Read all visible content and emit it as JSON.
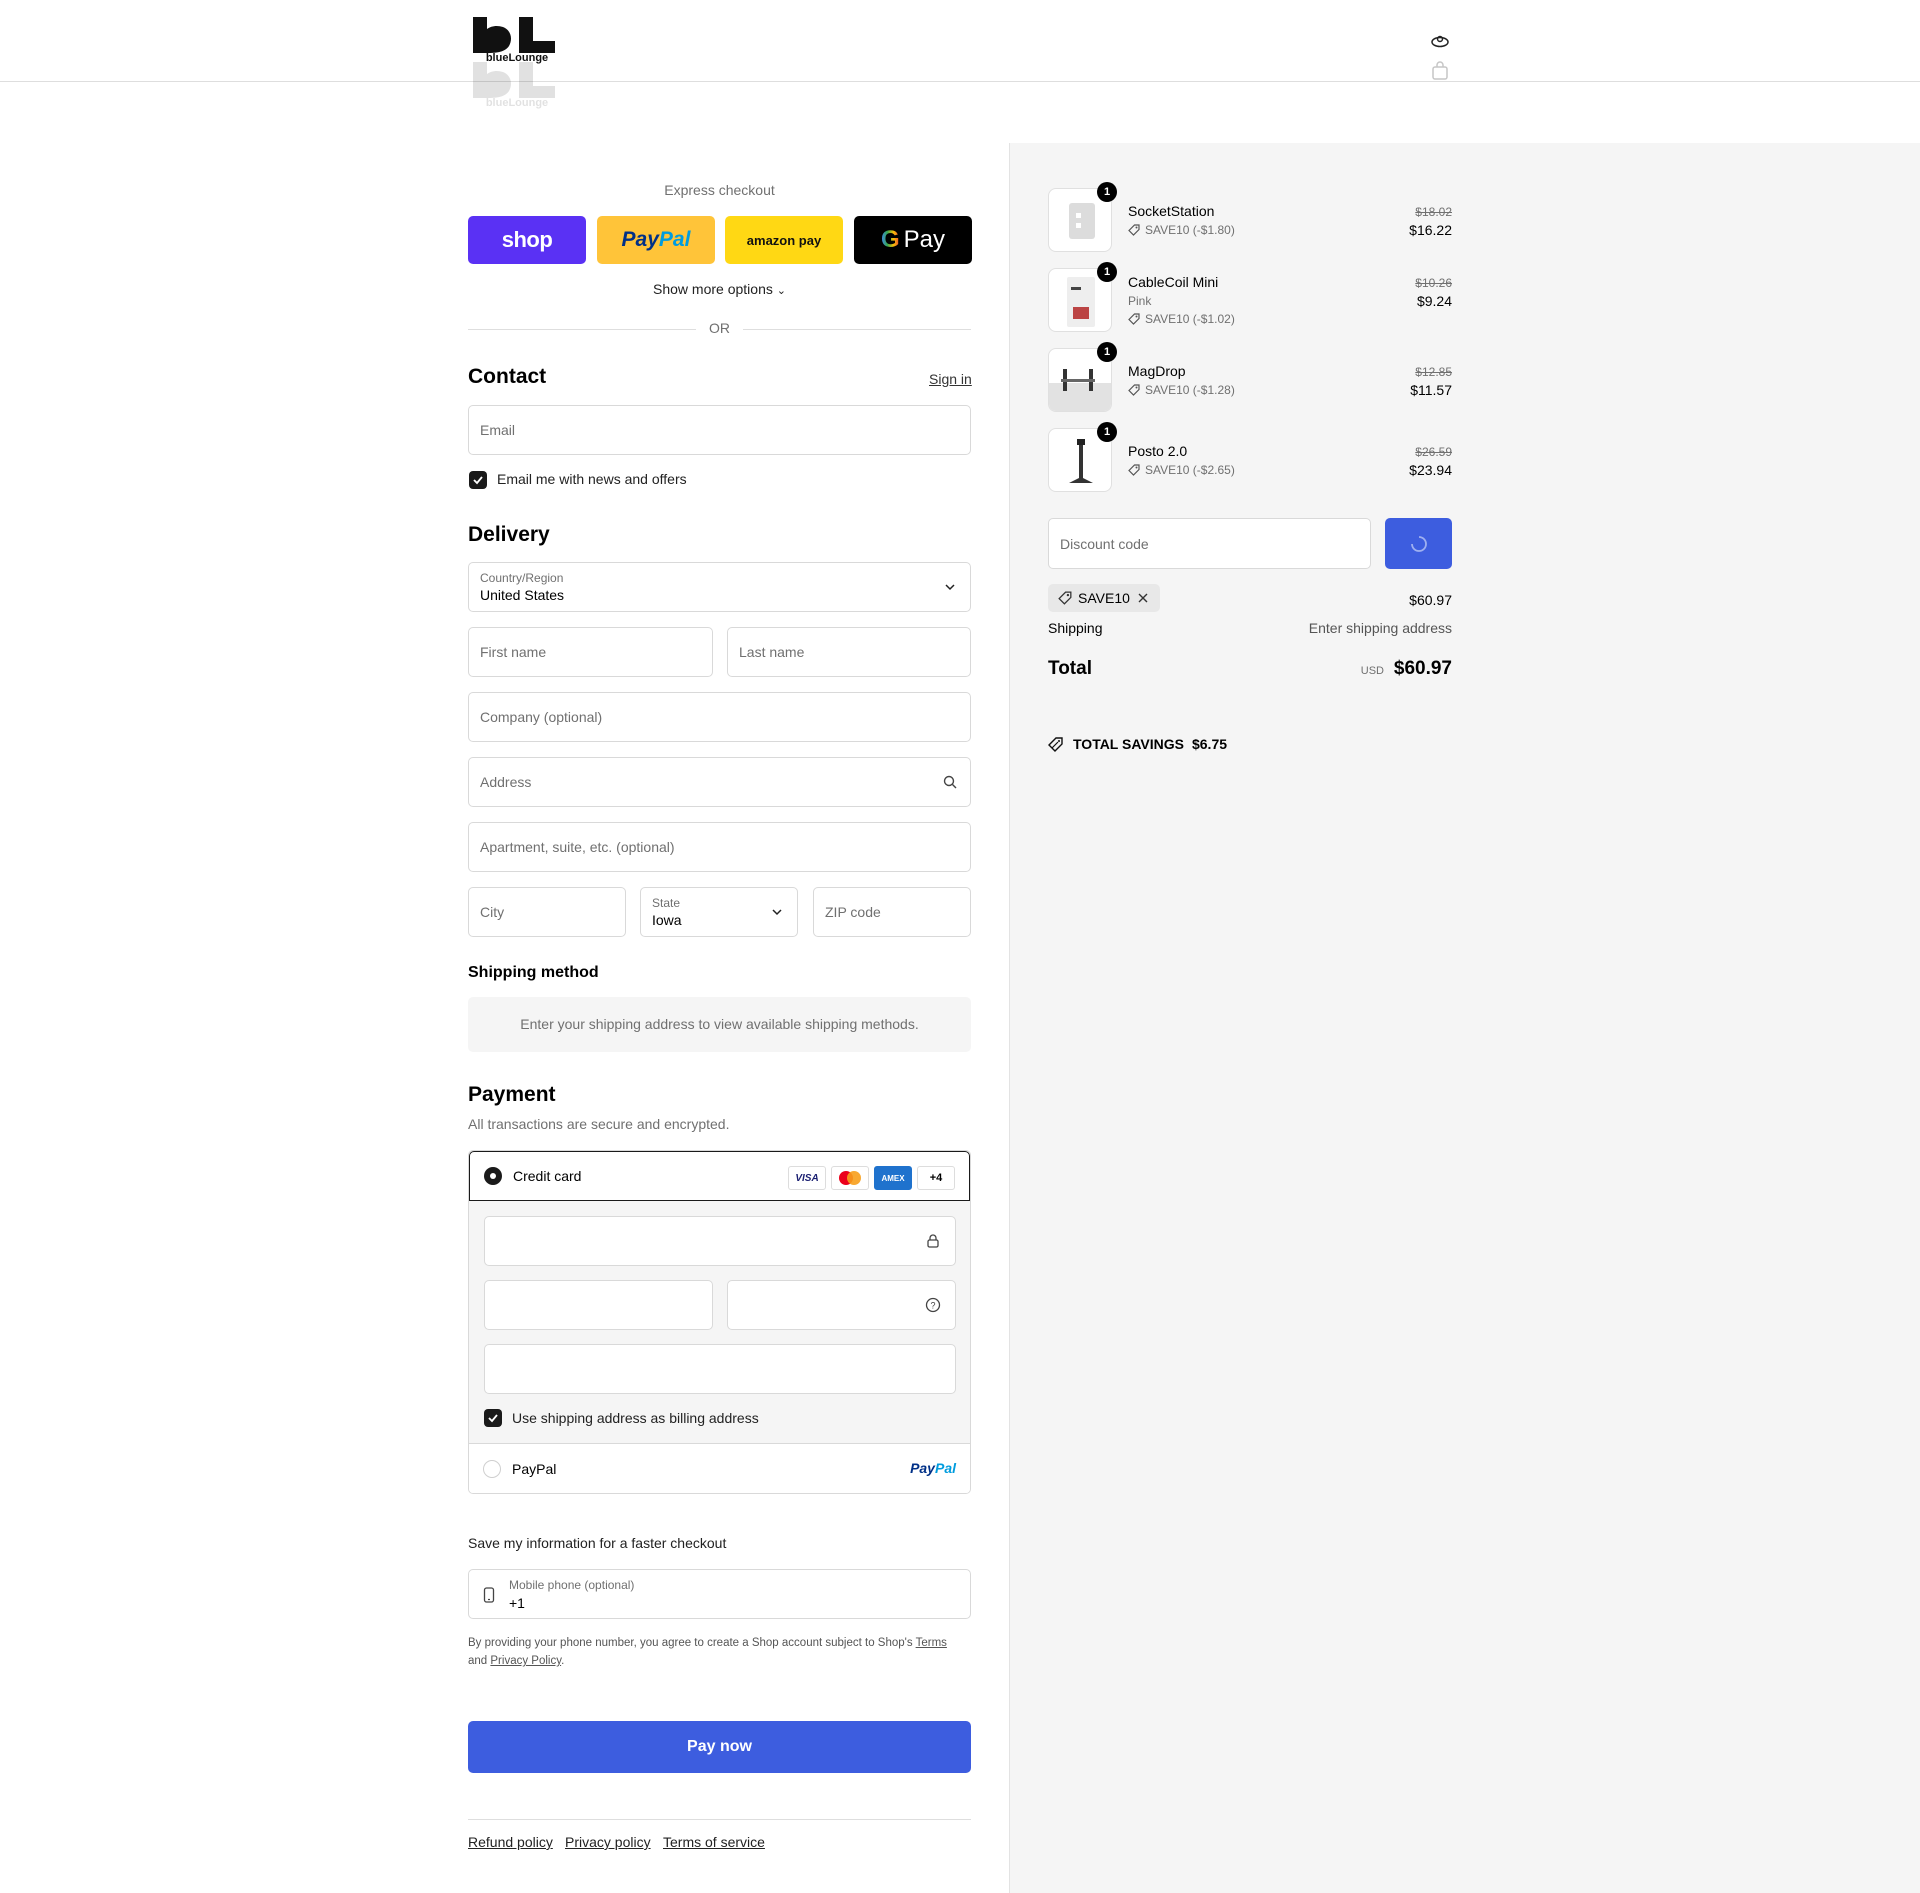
{
  "header": {
    "logo_text": "blueLounge",
    "account_icon": "account-icon",
    "bag_icon": "bag-icon"
  },
  "express": {
    "title": "Express checkout",
    "shop_label": "shop",
    "paypal_label": "PayPal",
    "amazon_label": "amazon pay",
    "gpay_label": "Pay",
    "more_options": "Show more options",
    "or": "OR"
  },
  "contact": {
    "title": "Contact",
    "signin": "Sign in",
    "email_placeholder": "Email",
    "news_label": "Email me with news and offers",
    "news_checked": true
  },
  "delivery": {
    "title": "Delivery",
    "country_label": "Country/Region",
    "country_value": "United States",
    "first_name": "First name",
    "last_name": "Last name",
    "company": "Company (optional)",
    "address": "Address",
    "apartment": "Apartment, suite, etc. (optional)",
    "city": "City",
    "state_label": "State",
    "state_value": "Iowa",
    "zip": "ZIP code"
  },
  "shipping_method": {
    "title": "Shipping method",
    "message": "Enter your shipping address to view available shipping methods."
  },
  "payment": {
    "title": "Payment",
    "subtitle": "All transactions are secure and encrypted.",
    "credit_card_label": "Credit card",
    "cards": [
      "VISA",
      "MC",
      "AMEX",
      "+4"
    ],
    "billing_label": "Use shipping address as billing address",
    "paypal_label": "PayPal",
    "paypal_logo": "PayPal"
  },
  "save_info": {
    "title": "Save my information for a faster checkout",
    "phone_label": "Mobile phone (optional)",
    "phone_value": "+1",
    "terms_prefix": "By providing your phone number, you agree to create a Shop account subject to Shop's",
    "terms_link": "Terms",
    "and": "and",
    "privacy_link": "Privacy Policy",
    "period": "."
  },
  "pay_now": "Pay now",
  "footer": {
    "refund": "Refund policy",
    "privacy": "Privacy policy",
    "terms": "Terms of service"
  },
  "summary": {
    "items": [
      {
        "name": "SocketStation",
        "variant": "",
        "discount": "SAVE10 (-$1.80)",
        "old_price": "$18.02",
        "price": "$16.22",
        "qty": "1"
      },
      {
        "name": "CableCoil Mini",
        "variant": "Pink",
        "discount": "SAVE10 (-$1.02)",
        "old_price": "$10.26",
        "price": "$9.24",
        "qty": "1"
      },
      {
        "name": "MagDrop",
        "variant": "",
        "discount": "SAVE10 (-$1.28)",
        "old_price": "$12.85",
        "price": "$11.57",
        "qty": "1"
      },
      {
        "name": "Posto 2.0",
        "variant": "",
        "discount": "SAVE10 (-$2.65)",
        "old_price": "$26.59",
        "price": "$23.94",
        "qty": "1"
      }
    ],
    "discount_placeholder": "Discount code",
    "applied_code": "SAVE10",
    "subtotal": "$60.97",
    "shipping_label": "Shipping",
    "shipping_value": "Enter shipping address",
    "total_label": "Total",
    "currency": "USD",
    "total_value": "$60.97",
    "savings_label": "TOTAL SAVINGS",
    "savings_value": "$6.75"
  },
  "colors": {
    "accent": "#3d5ddf",
    "shop": "#5a31f4",
    "paypal": "#ffc439",
    "amazon": "#ffd814"
  }
}
